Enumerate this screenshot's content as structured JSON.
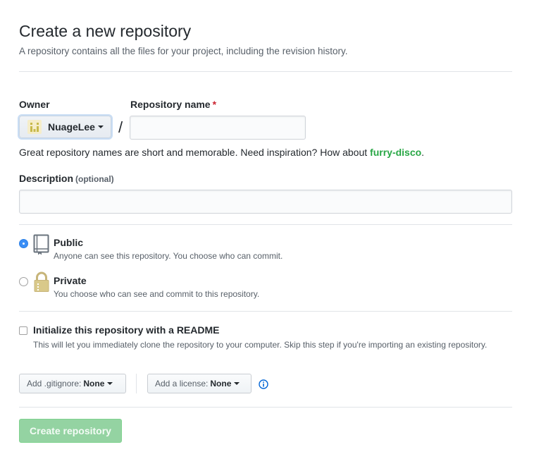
{
  "header": {
    "title": "Create a new repository",
    "subtitle": "A repository contains all the files for your project, including the revision history."
  },
  "owner": {
    "label": "Owner",
    "value": "NuageLee",
    "avatar_icon": "identicon-avatar"
  },
  "separator": "/",
  "repo_name": {
    "label": "Repository name",
    "required_marker": "*",
    "value": "",
    "placeholder": ""
  },
  "name_hint": {
    "text": "Great repository names are short and memorable. Need inspiration? How about ",
    "suggestion": "furry-disco",
    "trailing": "."
  },
  "description": {
    "label": "Description",
    "optional_note": "(optional)",
    "value": "",
    "placeholder": ""
  },
  "visibility": {
    "selected": "public",
    "options": [
      {
        "id": "public",
        "title": "Public",
        "desc": "Anyone can see this repository. You choose who can commit.",
        "icon": "repo-book-icon"
      },
      {
        "id": "private",
        "title": "Private",
        "desc": "You choose who can see and commit to this repository.",
        "icon": "lock-icon"
      }
    ]
  },
  "readme": {
    "checked": false,
    "title": "Initialize this repository with a README",
    "desc": "This will let you immediately clone the repository to your computer. Skip this step if you're importing an existing repository."
  },
  "gitignore": {
    "prefix": "Add .gitignore:",
    "value": "None"
  },
  "license": {
    "prefix": "Add a license:",
    "value": "None"
  },
  "info_icon": "info-icon",
  "submit": {
    "label": "Create repository",
    "disabled": true
  },
  "colors": {
    "accent_blue": "#0366d6",
    "suggestion_green": "#28a745",
    "required_red": "#cb2431",
    "disabled_button": "#94d3a2"
  }
}
